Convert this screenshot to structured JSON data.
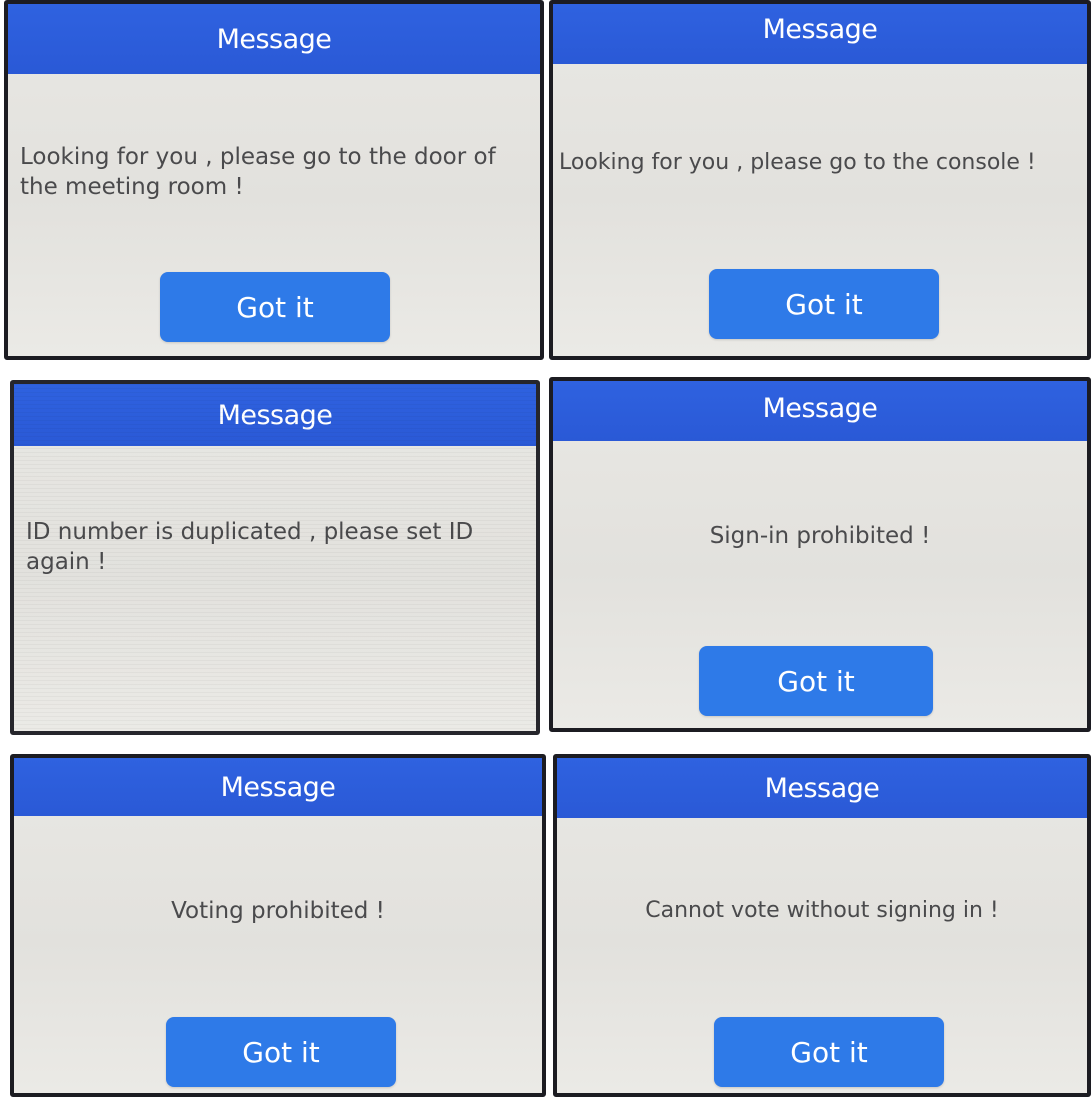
{
  "panels": [
    {
      "title": "Message",
      "message": "Looking for you , please go to the door of the meeting room !",
      "button": "Got it"
    },
    {
      "title": "Message",
      "message": "Looking for you , please go to the console !",
      "button": "Got it"
    },
    {
      "title": "Message",
      "message": "ID number is duplicated , please set ID again !"
    },
    {
      "title": "Message",
      "message": "Sign-in prohibited !",
      "button": "Got it"
    },
    {
      "title": "Message",
      "message": "Voting prohibited !",
      "button": "Got it"
    },
    {
      "title": "Message",
      "message": "Cannot vote without signing in !",
      "button": "Got it"
    }
  ],
  "colors": {
    "titlebar": "#2f62e0",
    "button": "#2e7ae8",
    "background": "#e6e5e1",
    "text": "#4a4a4c"
  }
}
